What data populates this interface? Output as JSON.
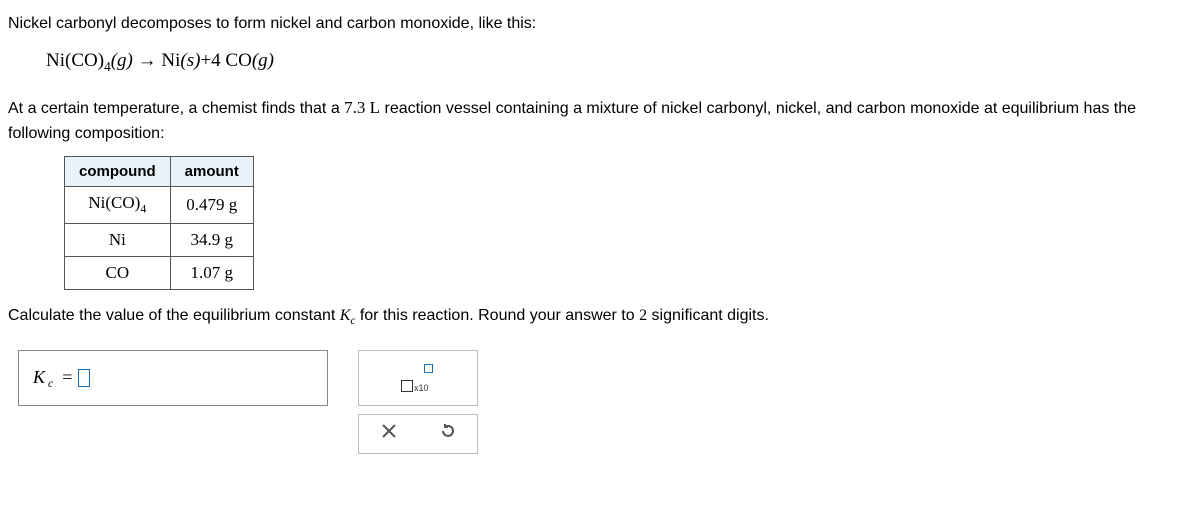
{
  "intro": "Nickel carbonyl decomposes to form nickel and carbon monoxide, like this:",
  "equation": {
    "lhs_compound": "Ni(CO)",
    "lhs_sub": "4",
    "lhs_state": "(g)",
    "arrow": "→",
    "rhs1": "Ni",
    "rhs1_state": "(s)",
    "plus": "+",
    "coef": "4",
    "rhs2": "CO",
    "rhs2_state": "(g)"
  },
  "context_a": "At a certain temperature, a chemist finds that a ",
  "context_vol": "7.3 L",
  "context_b": " reaction vessel containing a mixture of nickel carbonyl, nickel, and carbon monoxide at equilibrium has the following composition:",
  "table": {
    "headers": {
      "c1": "compound",
      "c2": "amount"
    },
    "rows": [
      {
        "compound_a": "Ni(CO)",
        "compound_sub": "4",
        "amount": "0.479 g"
      },
      {
        "compound_a": "Ni",
        "compound_sub": "",
        "amount": "34.9 g"
      },
      {
        "compound_a": "CO",
        "compound_sub": "",
        "amount": "1.07 g"
      }
    ]
  },
  "prompt_a": "Calculate the value of the equilibrium constant ",
  "prompt_k": "K",
  "prompt_ksub": "c",
  "prompt_b": " for this reaction. Round your answer to ",
  "prompt_sig": "2",
  "prompt_c": " significant digits.",
  "answer": {
    "k": "K",
    "ksub": "c",
    "equals": "="
  },
  "tools": {
    "x10": "x10"
  }
}
